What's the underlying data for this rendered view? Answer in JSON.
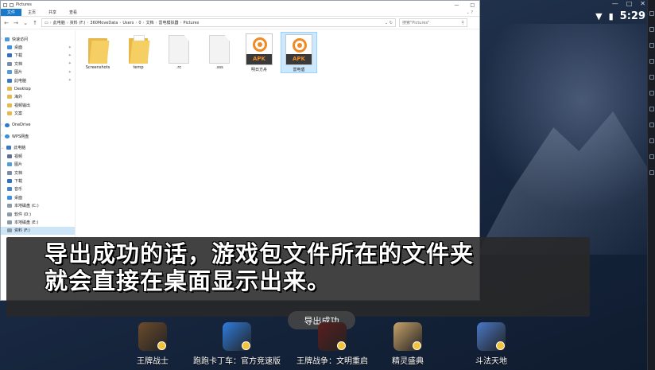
{
  "explorer": {
    "title": "Pictures",
    "ribbon_tabs": [
      "文件",
      "主页",
      "共享",
      "查看"
    ],
    "address": [
      "此电脑",
      "资料 (F:)",
      "360MoveData",
      "Users",
      "0",
      "文档",
      "雷电模拟器",
      "Pictures"
    ],
    "search_placeholder": "搜索\"Pictures\"",
    "nav": {
      "quick_access": "快速访问",
      "quick_items": [
        {
          "label": "桌面",
          "icon": "desktop-icon",
          "pinned": true
        },
        {
          "label": "下载",
          "icon": "download-icon",
          "pinned": true
        },
        {
          "label": "文档",
          "icon": "document-icon",
          "pinned": true
        },
        {
          "label": "图片",
          "icon": "picture-icon",
          "pinned": true
        },
        {
          "label": "此电脑",
          "icon": "pc-icon",
          "pinned": true
        },
        {
          "label": "Desktop",
          "icon": "folder-icon",
          "pinned": false
        },
        {
          "label": "海外",
          "icon": "folder-icon",
          "pinned": false
        },
        {
          "label": "视频输出",
          "icon": "folder-icon",
          "pinned": false
        },
        {
          "label": "文案",
          "icon": "folder-icon",
          "pinned": false
        }
      ],
      "onedrive": "OneDrive",
      "wps": "WPS网盘",
      "this_pc": "此电脑",
      "pc_items": [
        {
          "label": "视频",
          "icon": "video-icon"
        },
        {
          "label": "图片",
          "icon": "picture-icon"
        },
        {
          "label": "文档",
          "icon": "document-icon"
        },
        {
          "label": "下载",
          "icon": "download-icon"
        },
        {
          "label": "音乐",
          "icon": "music-icon"
        },
        {
          "label": "桌面",
          "icon": "desktop-icon"
        },
        {
          "label": "本地磁盘 (C:)",
          "icon": "drive-icon"
        },
        {
          "label": "软件 (D:)",
          "icon": "drive-icon"
        },
        {
          "label": "本地磁盘 (E:)",
          "icon": "drive-icon"
        },
        {
          "label": "资料 (F:)",
          "icon": "drive-icon",
          "selected": true
        }
      ]
    },
    "files": [
      {
        "label": "Screenshots",
        "kind": "folder"
      },
      {
        "label": "temp",
        "kind": "folder"
      },
      {
        "label": ".rc",
        "kind": "file"
      },
      {
        "label": ".sss",
        "kind": "file"
      },
      {
        "label": "明日方舟",
        "kind": "apk"
      },
      {
        "label": "雷电盾",
        "kind": "apk",
        "selected": true
      }
    ],
    "apk_tag": "APK"
  },
  "status": {
    "time": "5:29"
  },
  "caption": {
    "line1": "导出成功的话，游戏包文件所在的文件夹",
    "line2": "就会直接在桌面显示出来。"
  },
  "toast": "导出成功",
  "dock": [
    {
      "label": "王牌战士",
      "color": "#6d4c2e"
    },
    {
      "label": "跑跑卡丁车：官方竞速版",
      "color": "#2f7de0"
    },
    {
      "label": "王牌战争：文明重启",
      "color": "#5a1e1e"
    },
    {
      "label": "精灵盛典",
      "color": "#c9a36a"
    },
    {
      "label": "斗法天地",
      "color": "#4a78c8"
    }
  ],
  "colors": {
    "ribbon_file": "#1979ca",
    "selection": "#cce8ff",
    "apk_orange": "#f08a24"
  }
}
